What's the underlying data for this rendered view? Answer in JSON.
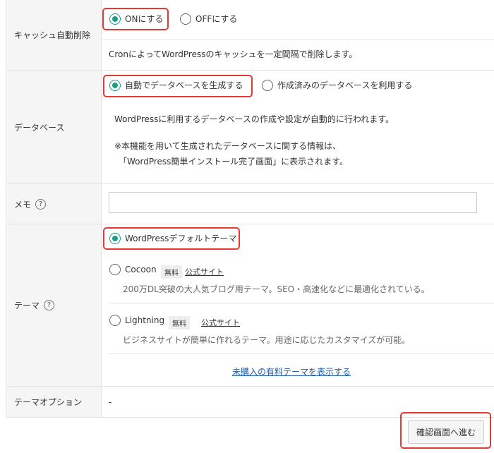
{
  "cache": {
    "label": "キャッシュ自動削除",
    "on_label": "ONにする",
    "off_label": "OFFにする",
    "description": "CronによってWordPressのキャッシュを一定間隔で削除します。"
  },
  "database": {
    "label": "データベース",
    "auto_label": "自動でデータベースを生成する",
    "existing_label": "作成済みのデータベースを利用する",
    "description": "WordPressに利用するデータベースの作成や設定が自動的に行われます。",
    "note_line1": "※本機能を用いて生成されたデータベースに関する情報は、",
    "note_line2": "「WordPress簡単インストール完了画面」に表示されます。"
  },
  "memo": {
    "label": "メモ",
    "help_icon": "?",
    "value": ""
  },
  "theme": {
    "label": "テーマ",
    "help_icon": "?",
    "default_label": "WordPressデフォルトテーマ",
    "options": [
      {
        "name": "Cocoon",
        "badge": "無料",
        "link": "公式サイト",
        "description": "200万DL突破の大人気ブログ用テーマ。SEO・高速化などに最適化されている。"
      },
      {
        "name": "Lightning",
        "badge": "無料",
        "link": "公式サイト",
        "description": "ビジネスサイトが簡単に作れるテーマ。用途に応じたカスタマイズが可能。"
      }
    ],
    "show_paid_link": "未購入の有料テーマを表示する"
  },
  "theme_option": {
    "label": "テーマオプション",
    "value": "-"
  },
  "confirm_button": "確認画面へ進む",
  "colors": {
    "accent": "#1a9e8a",
    "highlight": "#e53935",
    "link": "#1f5fa8",
    "label_bg": "#f5f5f5"
  }
}
